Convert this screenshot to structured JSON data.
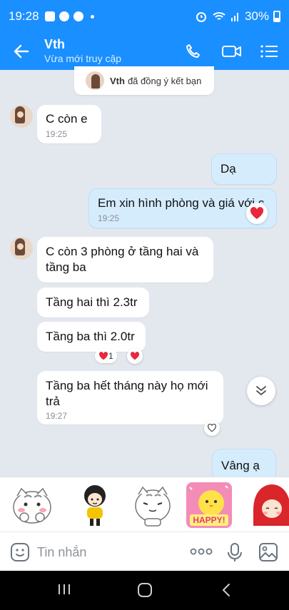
{
  "status": {
    "time": "19:28",
    "battery": "30%"
  },
  "header": {
    "contact_name": "Vth",
    "subtitle": "Vừa mới truy cập"
  },
  "notice": {
    "name": "Vth",
    "text": "đã đồng ý kết bạn"
  },
  "messages": [
    {
      "sender": "them",
      "text": "C còn e",
      "time": "19:25"
    },
    {
      "sender": "me",
      "text": "Dạ"
    },
    {
      "sender": "me",
      "text": "Em xin hình phòng và giá với c",
      "time": "19:25",
      "reaction": "heart"
    },
    {
      "sender": "them",
      "text": "C còn 3 phòng ở tầng hai và tầng ba"
    },
    {
      "sender": "them",
      "text": "Tầng hai thì 2.3tr"
    },
    {
      "sender": "them",
      "text": "Tầng ba thì 2.0tr",
      "reaction_count": "1"
    },
    {
      "sender": "them",
      "text": "Tầng ba hết tháng này họ mới trả",
      "time": "19:27"
    },
    {
      "sender": "me",
      "text": "Vâng ạ"
    }
  ],
  "stickers": {
    "happy_text": "HAPPY!"
  },
  "input": {
    "placeholder": "Tin nhắn"
  },
  "colors": {
    "header_blue": "#1a8fff",
    "my_bubble": "#d5ecfd",
    "heart_red": "#e8283c",
    "chat_bg": "#e3e8ef"
  }
}
